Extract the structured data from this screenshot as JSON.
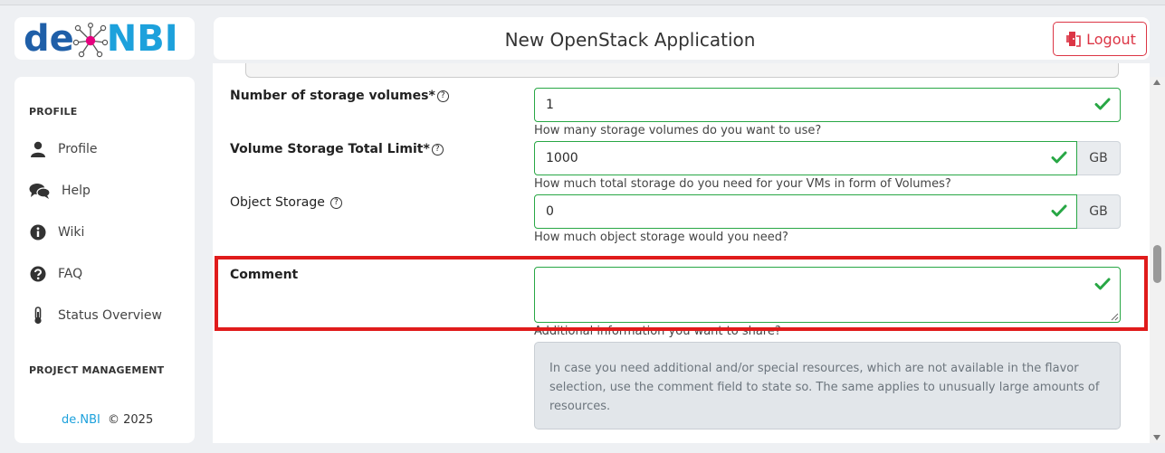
{
  "logo": {
    "part1": "de",
    "part2": "NBI"
  },
  "header": {
    "title": "New OpenStack Application",
    "logout_label": "Logout"
  },
  "sidebar": {
    "section_profile": "PROFILE",
    "items": [
      {
        "label": "Profile",
        "icon": "user-icon"
      },
      {
        "label": "Help",
        "icon": "comments-icon"
      },
      {
        "label": "Wiki",
        "icon": "info-circle-icon"
      },
      {
        "label": "FAQ",
        "icon": "question-circle-icon"
      },
      {
        "label": "Status Overview",
        "icon": "thermometer-icon"
      }
    ],
    "section_project": "PROJECT MANAGEMENT",
    "footer": {
      "brand": "de.NBI",
      "copyright": "© 2025"
    }
  },
  "form": {
    "storage_volumes": {
      "label": "Number of storage volumes*",
      "value": "1",
      "help": "How many storage volumes do you want to use?"
    },
    "volume_limit": {
      "label": "Volume Storage Total Limit*",
      "value": "1000",
      "unit": "GB",
      "help": "How much total storage do you need for your VMs in form of Volumes?"
    },
    "object_storage": {
      "label": "Object Storage",
      "value": "0",
      "unit": "GB",
      "help": "How much object storage would you need?"
    },
    "comment": {
      "label": "Comment",
      "value": "",
      "help": "Additional information you want to share?"
    },
    "info_text": "In case you need additional and/or special resources, which are not available in the flavor selection, use the comment field to state so. The same applies to unusually large amounts of resources."
  },
  "colors": {
    "valid": "#28a745",
    "highlight": "#e01b1b",
    "danger": "#dc3545",
    "brand_dark": "#1f5fa8",
    "brand_light": "#1da1dc"
  }
}
